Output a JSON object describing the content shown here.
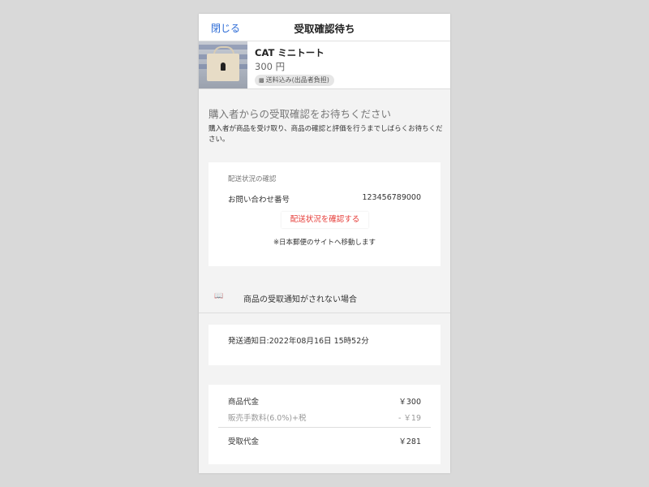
{
  "header": {
    "close_label": "閉じる",
    "title": "受取確認待ち"
  },
  "item": {
    "name": "CAT ミニトート",
    "price": "300 円",
    "shipping_badge": "送料込み(出品者負担)"
  },
  "status": {
    "heading": "購入者からの受取確認をお待ちください",
    "description": "購入者が商品を受け取り、商品の確認と評価を行うまでしばらくお待ちください。"
  },
  "delivery": {
    "section_label": "配送状況の確認",
    "inquiry_label": "お問い合わせ番号",
    "inquiry_number": "123456789000",
    "check_button_label": "配送状況を確認する",
    "note": "※日本郵便のサイトへ移動します"
  },
  "help": {
    "icon": "book-icon",
    "label": "商品の受取通知がされない場合"
  },
  "shipping_notice": {
    "text": "発送通知日:2022年08月16日 15時52分"
  },
  "price_breakdown": {
    "item_price_label": "商品代金",
    "item_price_value": "￥300",
    "fee_label": "販売手数料(6.0%)+税",
    "fee_value": "- ￥19",
    "receive_label": "受取代金",
    "receive_value": "￥281"
  },
  "colors": {
    "accent_link": "#2a6ad6",
    "button_red": "#e53935",
    "background": "#f3f3f3"
  }
}
